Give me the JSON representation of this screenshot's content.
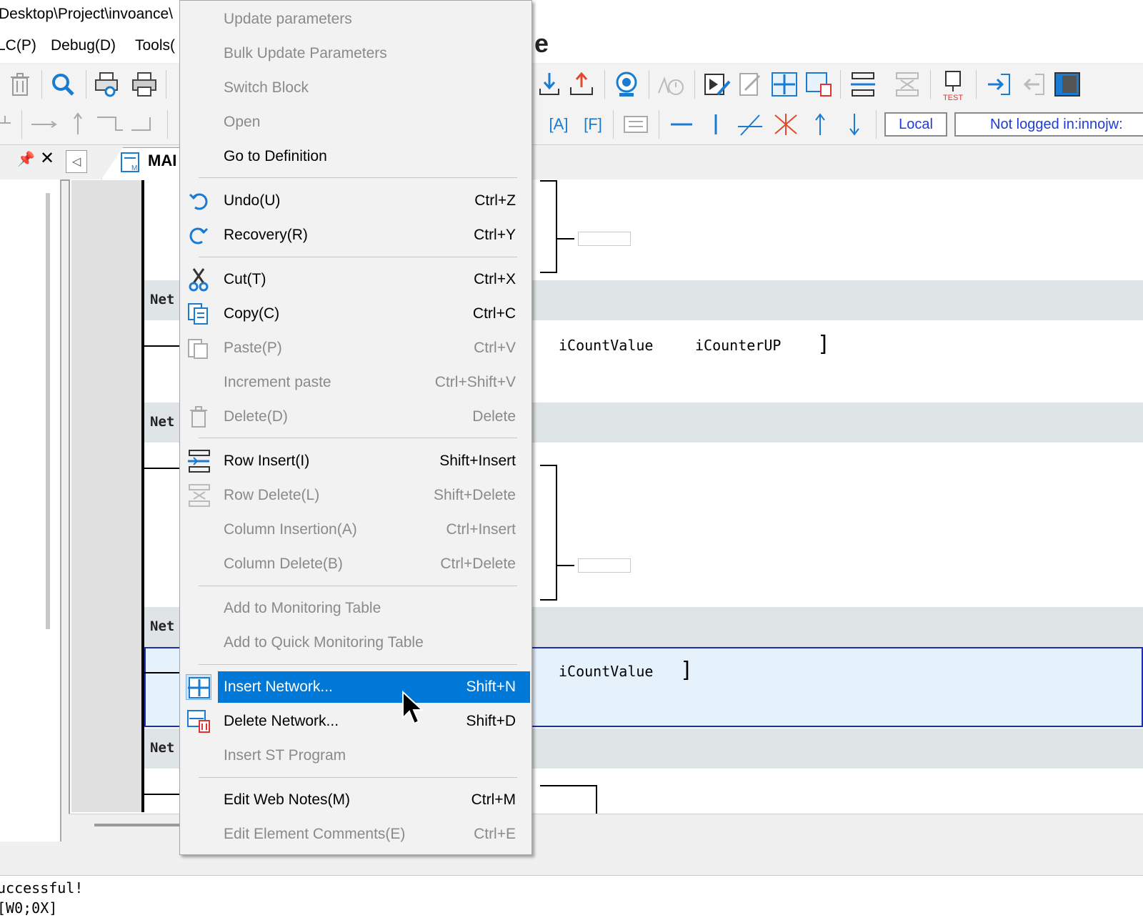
{
  "window": {
    "path": "Desktop\\Project\\invoance\\",
    "title_fragment": "e"
  },
  "menubar": {
    "items": [
      "LC(P)",
      "Debug(D)",
      "Tools("
    ]
  },
  "toolbar2": {
    "insert_a": "[A]",
    "insert_f": "[F]",
    "local_label": "Local",
    "login_status": "Not logged in:innojw:"
  },
  "tabs": {
    "main_tab": "MAI"
  },
  "editor": {
    "net_labels": [
      "Net",
      "Net",
      "Net",
      "Net"
    ],
    "net1_vars": [
      "iCountValue",
      "iCounterUP"
    ],
    "net3_vars": [
      "iCountValue"
    ],
    "bracket": "]"
  },
  "output": {
    "line1": "uccessful!",
    "line2": "                                         [W0;0X]"
  },
  "context_menu": {
    "items": [
      {
        "label": "Update parameters",
        "shortcut": "",
        "icon": "",
        "disabled": true
      },
      {
        "label": "Bulk Update Parameters",
        "shortcut": "",
        "icon": "",
        "disabled": true
      },
      {
        "label": "Switch Block",
        "shortcut": "",
        "icon": "",
        "disabled": true
      },
      {
        "label": "Open",
        "shortcut": "",
        "icon": "",
        "disabled": true
      },
      {
        "label": "Go to Definition",
        "shortcut": "",
        "icon": "",
        "disabled": false
      },
      {
        "label": "Undo(U)",
        "shortcut": "Ctrl+Z",
        "icon": "undo-icon",
        "disabled": false
      },
      {
        "label": "Recovery(R)",
        "shortcut": "Ctrl+Y",
        "icon": "redo-icon",
        "disabled": false
      },
      {
        "label": "Cut(T)",
        "shortcut": "Ctrl+X",
        "icon": "cut-icon",
        "disabled": false
      },
      {
        "label": "Copy(C)",
        "shortcut": "Ctrl+C",
        "icon": "copy-icon",
        "disabled": false
      },
      {
        "label": "Paste(P)",
        "shortcut": "Ctrl+V",
        "icon": "paste-icon",
        "disabled": true
      },
      {
        "label": "Increment paste",
        "shortcut": "Ctrl+Shift+V",
        "icon": "",
        "disabled": true
      },
      {
        "label": "Delete(D)",
        "shortcut": "Delete",
        "icon": "trash-icon",
        "disabled": true
      },
      {
        "label": "Row Insert(I)",
        "shortcut": "Shift+Insert",
        "icon": "row-insert-icon",
        "disabled": false
      },
      {
        "label": "Row Delete(L)",
        "shortcut": "Shift+Delete",
        "icon": "row-delete-icon",
        "disabled": true
      },
      {
        "label": "Column Insertion(A)",
        "shortcut": "Ctrl+Insert",
        "icon": "",
        "disabled": true
      },
      {
        "label": "Column Delete(B)",
        "shortcut": "Ctrl+Delete",
        "icon": "",
        "disabled": true
      },
      {
        "label": "Add to Monitoring Table",
        "shortcut": "",
        "icon": "",
        "disabled": true
      },
      {
        "label": "Add to Quick Monitoring Table",
        "shortcut": "",
        "icon": "",
        "disabled": true
      },
      {
        "label": "Insert Network...",
        "shortcut": "Shift+N",
        "icon": "insert-network-icon",
        "disabled": false,
        "highlighted": true
      },
      {
        "label": "Delete Network...",
        "shortcut": "Shift+D",
        "icon": "delete-network-icon",
        "disabled": false
      },
      {
        "label": "Insert ST Program",
        "shortcut": "",
        "icon": "",
        "disabled": true
      },
      {
        "label": "Edit Web Notes(M)",
        "shortcut": "Ctrl+M",
        "icon": "",
        "disabled": false
      },
      {
        "label": "Edit Element Comments(E)",
        "shortcut": "Ctrl+E",
        "icon": "",
        "disabled": true
      }
    ]
  },
  "colors": {
    "highlight": "#0078d7",
    "status_text": "#1e3cd7",
    "selected_network_border": "#1c2fb3"
  }
}
